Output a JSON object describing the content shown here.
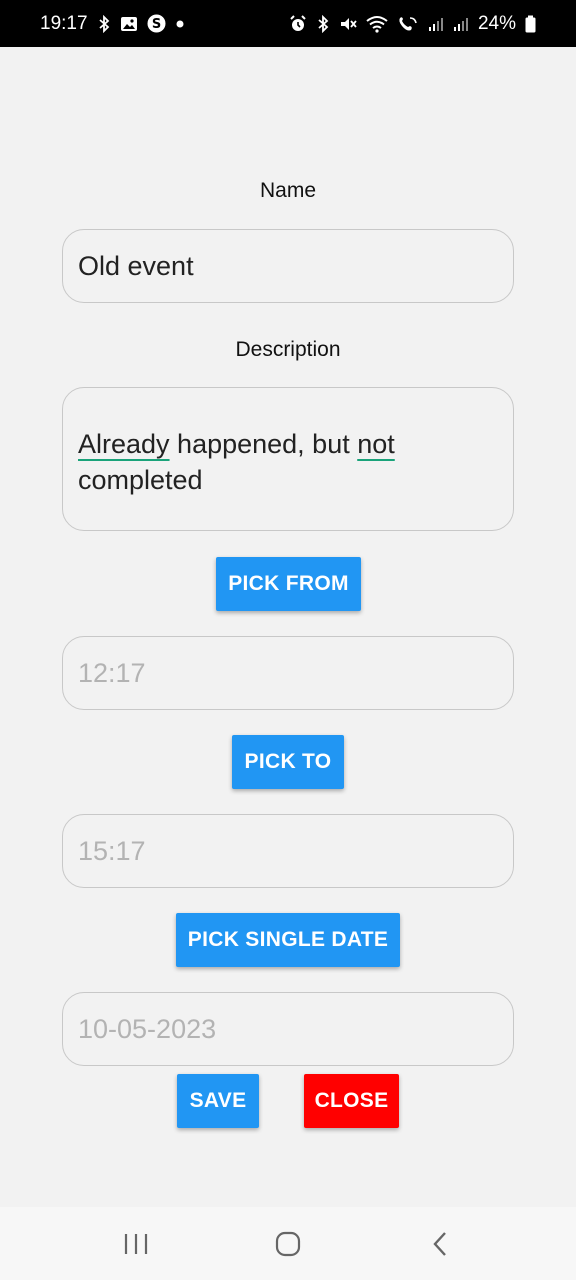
{
  "status_bar": {
    "time": "19:17",
    "battery_text": "24%",
    "left_icons": [
      "bluetooth-icon",
      "gallery-icon",
      "s-app-icon",
      "dot-icon"
    ],
    "right_icons": [
      "alarm-icon",
      "bluetooth-icon",
      "mute-icon",
      "wifi-icon",
      "wifi-call-icon",
      "signal-icon",
      "signal-icon",
      "battery-icon"
    ]
  },
  "form": {
    "name_label": "Name",
    "name_value": "Old event",
    "description_label": "Description",
    "description_value_parts": [
      "Already",
      " happened, but ",
      "not",
      " completed"
    ],
    "pick_from_label": "PICK FROM",
    "from_value": "12:17",
    "pick_to_label": "PICK TO",
    "to_value": "15:17",
    "pick_single_date_label": "PICK SINGLE DATE",
    "date_value": "10-05-2023",
    "save_label": "SAVE",
    "close_label": "CLOSE"
  },
  "colors": {
    "primary_button": "#2196f3",
    "close_button": "#ff0000",
    "spellcheck_underline": "#1aa37a"
  },
  "nav_bar": {
    "icons": [
      "recent-apps-icon",
      "home-icon",
      "back-icon"
    ]
  }
}
